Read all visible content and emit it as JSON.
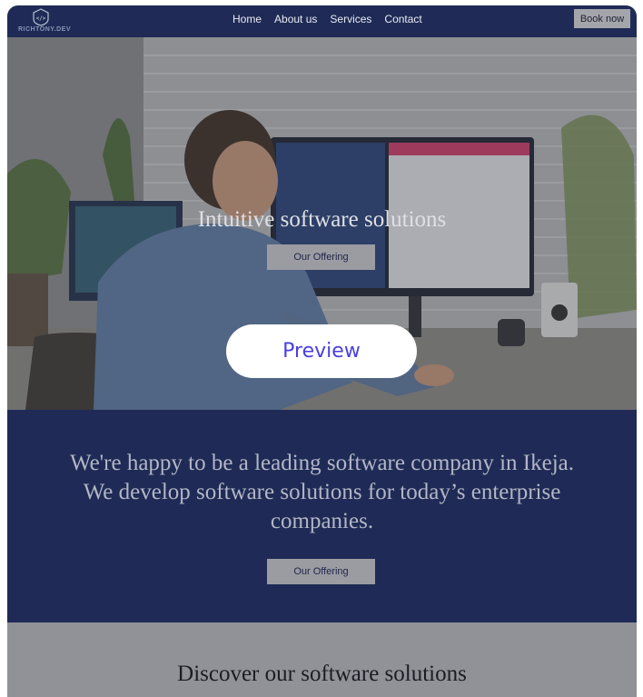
{
  "brand": {
    "logo_text": "RICHTONY.DEV"
  },
  "nav": {
    "links": [
      "Home",
      "About us",
      "Services",
      "Contact"
    ],
    "book_label": "Book now"
  },
  "hero": {
    "title": "Intuitive software solutions",
    "offer_label": "Our Offering",
    "preview_label": "Preview"
  },
  "about": {
    "text": "We're happy to be a leading software company in Ikeja. We develop software solutions for today’s enterprise companies.",
    "offer_label": "Our Offering"
  },
  "discover": {
    "title": "Discover our software solutions"
  },
  "colors": {
    "nav_bg": "#1f2b56",
    "accent": "#4a3fe0",
    "button_bg": "#9a9ca2"
  }
}
